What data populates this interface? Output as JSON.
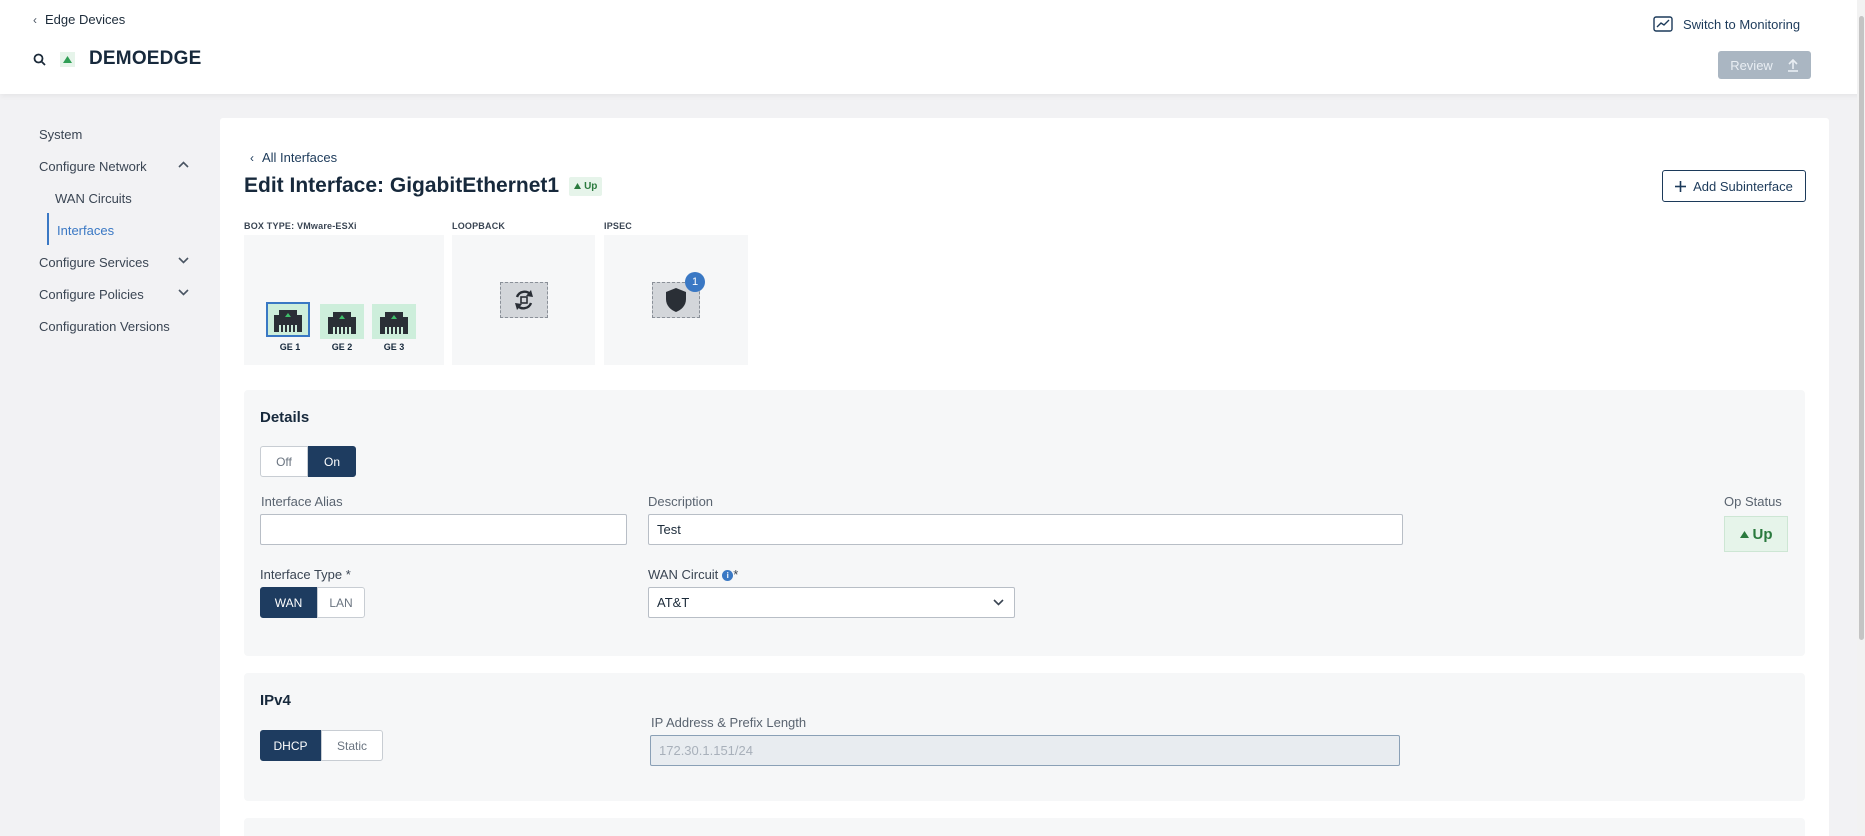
{
  "header": {
    "back_label": "Edge Devices",
    "device_name": "DEMOEDGE",
    "monitor_label": "Switch to Monitoring",
    "review_label": "Review"
  },
  "sidebar": {
    "items": [
      {
        "label": "System"
      },
      {
        "label": "Configure Network",
        "expanded": true
      },
      {
        "label": "WAN Circuits"
      },
      {
        "label": "Interfaces",
        "active": true
      },
      {
        "label": "Configure Services",
        "expanded": false
      },
      {
        "label": "Configure Policies",
        "expanded": false
      },
      {
        "label": "Configuration Versions"
      }
    ]
  },
  "main": {
    "back_label": "All Interfaces",
    "title": "Edit Interface: GigabitEthernet1",
    "status_badge": "Up",
    "add_subinterface_label": "Add Subinterface",
    "boxes": {
      "box_type_label": "BOX TYPE: VMware-ESXi",
      "loopback_label": "LOOPBACK",
      "ipsec_label": "IPSEC",
      "ports": [
        "GE 1",
        "GE 2",
        "GE 3"
      ],
      "ipsec_count": "1"
    },
    "details": {
      "title": "Details",
      "toggle": {
        "off": "Off",
        "on": "On",
        "selected": "On"
      },
      "alias_label": "Interface Alias",
      "alias_value": "",
      "description_label": "Description",
      "description_value": "Test",
      "op_status_label": "Op Status",
      "op_status_value": "Up",
      "type_label": "Interface Type *",
      "type": {
        "wan": "WAN",
        "lan": "LAN",
        "selected": "WAN"
      },
      "wan_circuit_label": "WAN Circuit",
      "wan_circuit_required": "*",
      "wan_circuit_value": "AT&T"
    },
    "ipv4": {
      "title": "IPv4",
      "mode": {
        "dhcp": "DHCP",
        "static": "Static",
        "selected": "DHCP"
      },
      "ip_label": "IP Address & Prefix Length",
      "ip_value": "172.30.1.151/24"
    }
  },
  "colors": {
    "accent": "#3a78c4",
    "primary_dark": "#1e3c60",
    "status_green": "#2a7a3e"
  }
}
